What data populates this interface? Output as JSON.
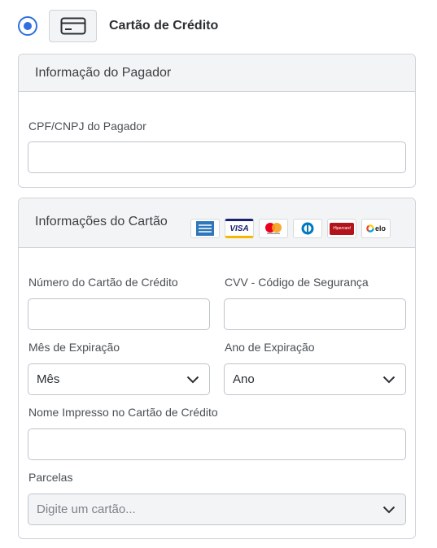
{
  "payment_method": {
    "label": "Cartão de Crédito",
    "selected": true,
    "icon": "credit-card-icon"
  },
  "payer_section": {
    "title": "Informação do Pagador",
    "document_label": "CPF/CNPJ do Pagador",
    "document_value": ""
  },
  "card_section": {
    "title": "Informações do Cartão",
    "brands": [
      {
        "name": "amex-logo"
      },
      {
        "name": "visa-logo",
        "text": "VISA"
      },
      {
        "name": "mastercard-logo"
      },
      {
        "name": "diners-logo"
      },
      {
        "name": "hipercard-logo",
        "text": "Hipercard"
      },
      {
        "name": "elo-logo",
        "text": "elo"
      }
    ],
    "number_label": "Número do Cartão de Crédito",
    "cvv_label": "CVV - Código de Segurança",
    "exp_month_label": "Mês de Expiração",
    "exp_month_value": "Mês",
    "exp_year_label": "Ano de Expiração",
    "exp_year_value": "Ano",
    "name_label": "Nome Impresso no Cartão de Crédito",
    "installments_label": "Parcelas",
    "installments_value": "Digite um cartão..."
  },
  "colors": {
    "accent": "#2f6fe0",
    "header_bg": "#f3f4f6",
    "border": "#cfd3d8"
  }
}
